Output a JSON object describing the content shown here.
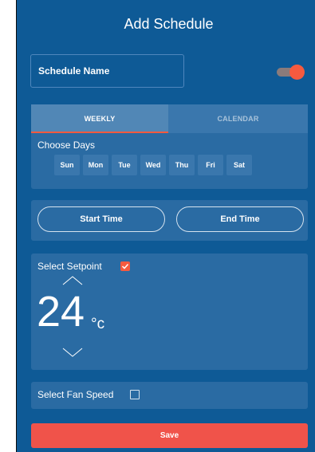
{
  "header": {
    "title": "Add Schedule"
  },
  "schedule_name": {
    "value": "Schedule Name",
    "enabled": true
  },
  "tabs": [
    {
      "label": "WEEKLY",
      "active": true
    },
    {
      "label": "CALENDAR",
      "active": false
    }
  ],
  "days": {
    "label": "Choose Days",
    "items": [
      "Sun",
      "Mon",
      "Tue",
      "Wed",
      "Thu",
      "Fri",
      "Sat"
    ]
  },
  "time": {
    "start_label": "Start Time",
    "end_label": "End Time"
  },
  "setpoint": {
    "label": "Select Setpoint",
    "checked": true,
    "value": "24",
    "unit": "°c"
  },
  "fan": {
    "label": "Select Fan Speed",
    "checked": false
  },
  "save": {
    "label": "Save"
  },
  "colors": {
    "background": "#0e5a96",
    "panel": "#2a6ba3",
    "accent": "#f55a3f",
    "save": "#f0534a"
  },
  "icons": {
    "up": "chevron-up-icon",
    "down": "chevron-down-icon",
    "checkbox_checked": "checkbox-checked-icon",
    "checkbox_empty": "checkbox-empty-icon"
  }
}
